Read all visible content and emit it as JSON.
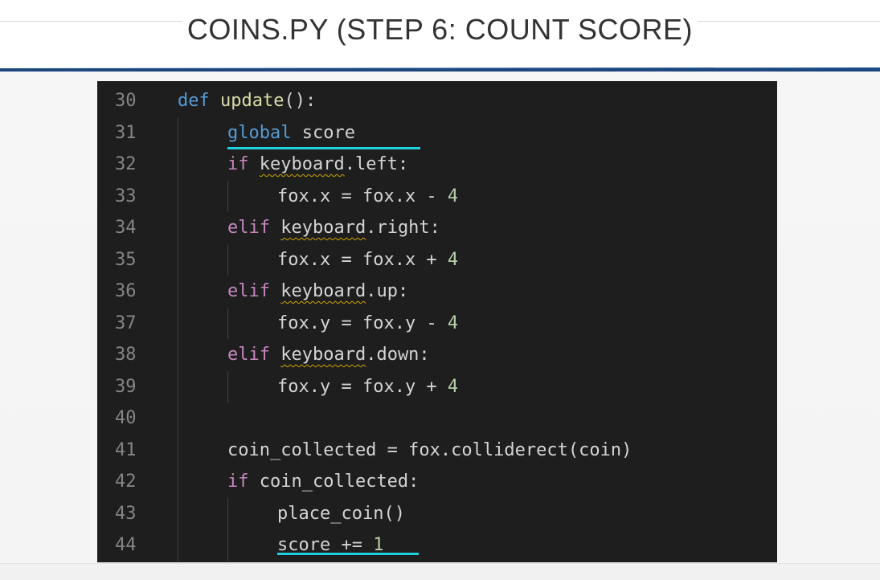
{
  "slide": {
    "title": "COINS.PY (STEP 6: COUNT SCORE)"
  },
  "editor": {
    "lines": [
      {
        "num": "30",
        "indent": 0,
        "tokens": [
          {
            "t": "def",
            "c": "kw-blue"
          },
          {
            "t": " "
          },
          {
            "t": "update",
            "c": "fn"
          },
          {
            "t": "():"
          }
        ]
      },
      {
        "num": "31",
        "indent": 1,
        "tokens": [
          {
            "t": "global",
            "c": "kw-blue"
          },
          {
            "t": " score"
          }
        ]
      },
      {
        "num": "32",
        "indent": 1,
        "tokens": [
          {
            "t": "if",
            "c": "kw-purple"
          },
          {
            "t": " "
          },
          {
            "t": "keyboard",
            "c": "squig"
          },
          {
            "t": ".left:"
          }
        ]
      },
      {
        "num": "33",
        "indent": 2,
        "tokens": [
          {
            "t": "fox.x = fox.x - "
          },
          {
            "t": "4",
            "c": "num"
          }
        ]
      },
      {
        "num": "34",
        "indent": 1,
        "tokens": [
          {
            "t": "elif",
            "c": "kw-purple"
          },
          {
            "t": " "
          },
          {
            "t": "keyboard",
            "c": "squig"
          },
          {
            "t": ".right:"
          }
        ]
      },
      {
        "num": "35",
        "indent": 2,
        "tokens": [
          {
            "t": "fox.x = fox.x + "
          },
          {
            "t": "4",
            "c": "num"
          }
        ]
      },
      {
        "num": "36",
        "indent": 1,
        "tokens": [
          {
            "t": "elif",
            "c": "kw-purple"
          },
          {
            "t": " "
          },
          {
            "t": "keyboard",
            "c": "squig"
          },
          {
            "t": ".up:"
          }
        ]
      },
      {
        "num": "37",
        "indent": 2,
        "tokens": [
          {
            "t": "fox.y = fox.y - "
          },
          {
            "t": "4",
            "c": "num"
          }
        ]
      },
      {
        "num": "38",
        "indent": 1,
        "tokens": [
          {
            "t": "elif",
            "c": "kw-purple"
          },
          {
            "t": " "
          },
          {
            "t": "keyboard",
            "c": "squig"
          },
          {
            "t": ".down:"
          }
        ]
      },
      {
        "num": "39",
        "indent": 2,
        "tokens": [
          {
            "t": "fox.y = fox.y + "
          },
          {
            "t": "4",
            "c": "num"
          }
        ]
      },
      {
        "num": "40",
        "indent": 0,
        "tokens": []
      },
      {
        "num": "41",
        "indent": 1,
        "tokens": [
          {
            "t": "coin_collected = fox.colliderect(coin)"
          }
        ]
      },
      {
        "num": "42",
        "indent": 1,
        "tokens": [
          {
            "t": "if",
            "c": "kw-purple"
          },
          {
            "t": " coin_collected:"
          }
        ]
      },
      {
        "num": "43",
        "indent": 2,
        "tokens": [
          {
            "t": "place_coin()"
          }
        ]
      },
      {
        "num": "44",
        "indent": 2,
        "tokens": [
          {
            "t": "score += "
          },
          {
            "t": "1",
            "c": "num"
          }
        ]
      }
    ]
  },
  "colors": {
    "editor_bg": "#1e1e1e",
    "title_rule": "#1f4e8a",
    "highlight": "#1fd1e0",
    "keyword_blue": "#569cd6",
    "keyword_purple": "#c586c0",
    "number": "#b5cea8",
    "function": "#dcdcaa"
  }
}
